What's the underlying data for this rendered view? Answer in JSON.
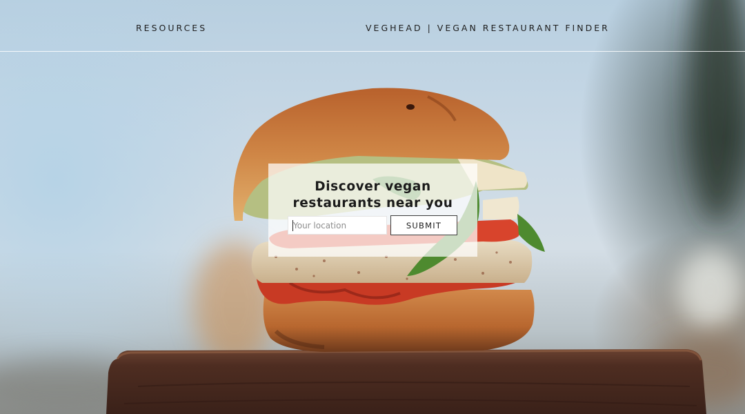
{
  "nav": {
    "resources_label": "RESOURCES",
    "brand_title": "VEGHEAD | VEGAN RESTAURANT FINDER"
  },
  "search": {
    "heading_line1": "Discover vegan",
    "heading_line2": "restaurants near you",
    "input_placeholder": "Your location",
    "input_value": "",
    "submit_label": "SUBMIT"
  },
  "colors": {
    "background_sky": "#c9d9e6",
    "bun": "#c9793c",
    "tomato": "#d8442c",
    "arugula": "#4e8a2f",
    "wood_board": "#5a3527",
    "card_overlay": "#ffffff"
  }
}
